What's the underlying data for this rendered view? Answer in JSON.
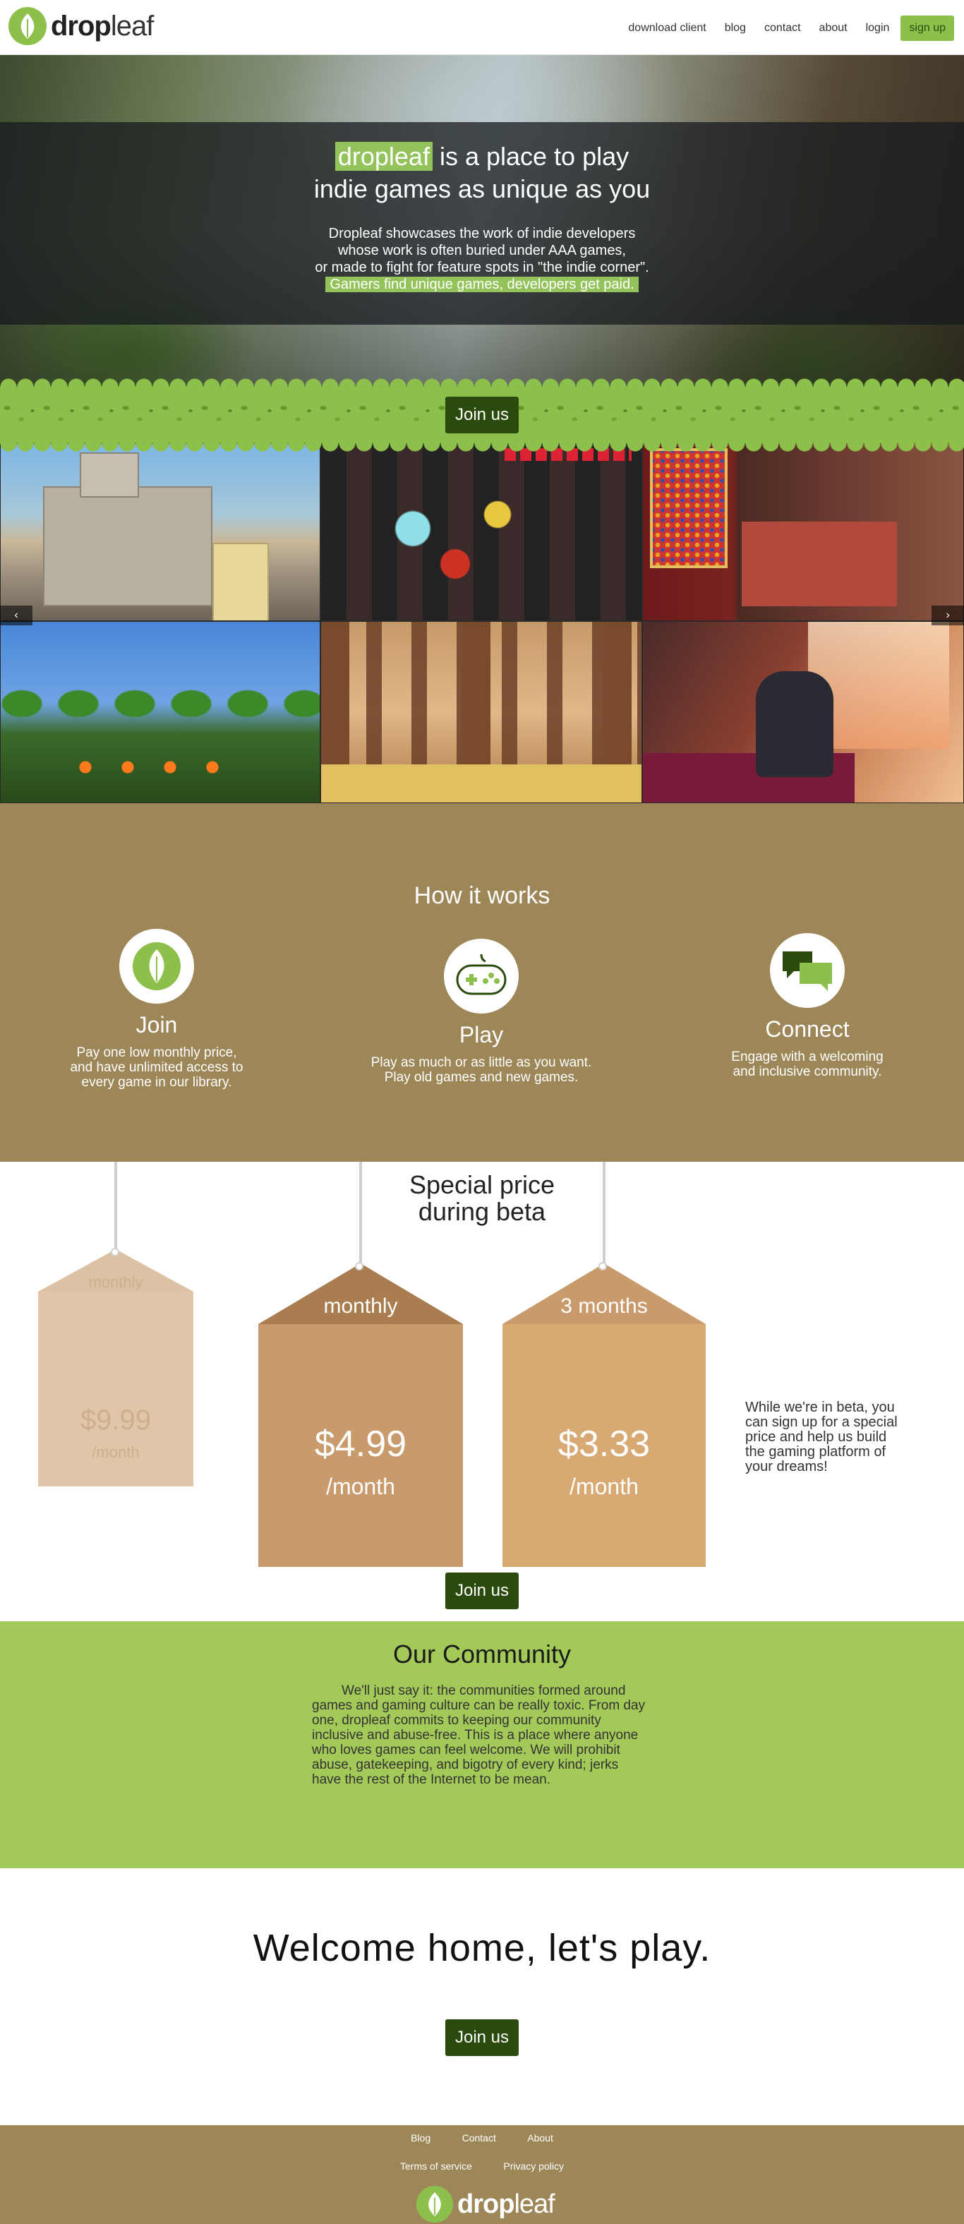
{
  "nav": {
    "logo_bold": "drop",
    "logo_light": "leaf",
    "links": [
      "download client",
      "blog",
      "contact",
      "about",
      "login"
    ],
    "signup": "sign up"
  },
  "hero": {
    "title_highlight": "dropleaf",
    "title_rest": " is a place to play",
    "title_line2": "indie games as unique as you",
    "lines": [
      "Dropleaf showcases the work of indie developers",
      "whose work is often buried under AAA games,",
      "or made to fight for feature spots in \"the indie corner\"."
    ],
    "highlight_line": "Gamers find unique games, developers get paid."
  },
  "join_label": "Join us",
  "carousel": {
    "prev": "‹",
    "next": "›"
  },
  "how": {
    "title": "How it works",
    "features": [
      {
        "title": "Join",
        "desc": [
          "Pay one low monthly price,",
          "and have unlimited access to",
          "every game in our library."
        ],
        "icon": "leaf-icon"
      },
      {
        "title": "Play",
        "desc": [
          "Play as much or as little as you want.",
          "Play old games and new games."
        ],
        "icon": "gamepad-icon"
      },
      {
        "title": "Connect",
        "desc": [
          "Engage with a welcoming",
          "and inclusive community."
        ],
        "icon": "chat-bubbles-icon"
      }
    ]
  },
  "pricing": {
    "title_line1": "Special price",
    "title_line2": "during beta",
    "old": {
      "period": "monthly",
      "price": "$9.99",
      "unit": "/month"
    },
    "plans": [
      {
        "period": "monthly",
        "price": "$4.99",
        "unit": "/month"
      },
      {
        "period": "3 months",
        "price": "$3.33",
        "unit": "/month"
      }
    ],
    "note": "While we're in beta, you can sign up for a special price and help us build the gaming platform of your dreams!"
  },
  "community": {
    "title": "Our Community",
    "text": "We'll just say it: the communities formed around games and gaming culture can be really toxic. From day one, dropleaf commits to keeping our community inclusive and abuse-free. This is a place where anyone who loves games can feel welcome. We will prohibit abuse, gatekeeping, and bigotry of every kind; jerks have the rest of the Internet to be mean."
  },
  "welcome": {
    "title": "Welcome home, let's play."
  },
  "footer": {
    "row1": [
      "Blog",
      "Contact",
      "About"
    ],
    "row2": [
      "Terms of service",
      "Privacy policy"
    ]
  },
  "colors": {
    "brand_green": "#8cc04a",
    "dark_green": "#2a4a0e",
    "tan": "#9d8758",
    "community_green": "#a3c959"
  }
}
